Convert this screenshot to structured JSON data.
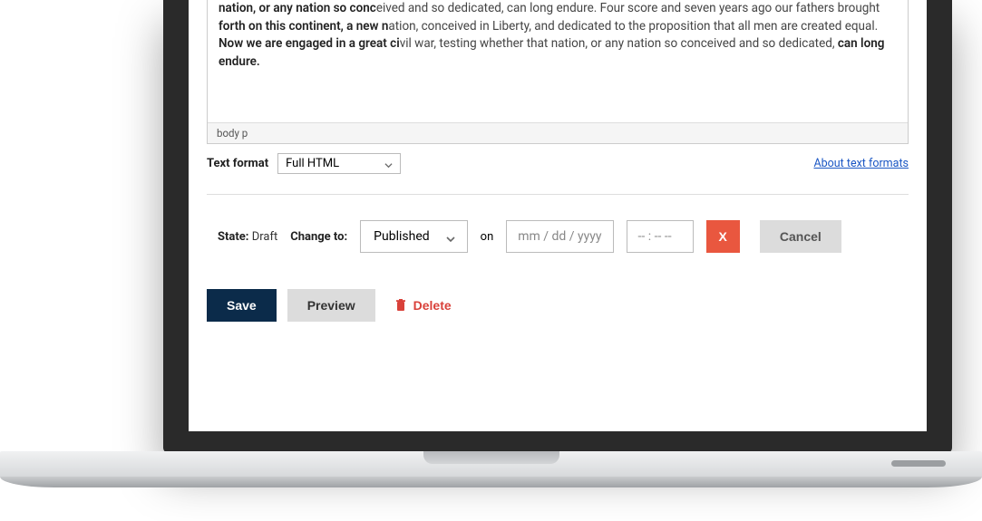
{
  "editor": {
    "content_segments": [
      {
        "text": "nation, or any nation so conc",
        "strong": true
      },
      {
        "text": "eived and so dedicated, can long endure. Four score and seven years ago our fathers brought ",
        "strong": false
      },
      {
        "text": "forth on this continent, a new n",
        "strong": true
      },
      {
        "text": "ation, conceived in Liberty, and dedicated to the proposition that all men are created equal. ",
        "strong": false
      },
      {
        "text": "Now we are engaged in a great ci",
        "strong": true
      },
      {
        "text": "vil war, testing whether that nation, or any nation so conceived and so dedicated, ",
        "strong": false
      },
      {
        "text": "can long endure.",
        "strong": true
      }
    ],
    "path": "body   p"
  },
  "format": {
    "label": "Text format",
    "selected": "Full HTML",
    "about_link": "About text formats"
  },
  "schedule": {
    "state_label": "State:",
    "state_value": "Draft",
    "change_to_label": "Change to:",
    "change_to_value": "Published",
    "on_label": "on",
    "date_placeholder": "mm / dd / yyyy",
    "time_placeholder": "-- : --  --",
    "clear_label": "X",
    "cancel_label": "Cancel"
  },
  "actions": {
    "save": "Save",
    "preview": "Preview",
    "delete": "Delete"
  }
}
